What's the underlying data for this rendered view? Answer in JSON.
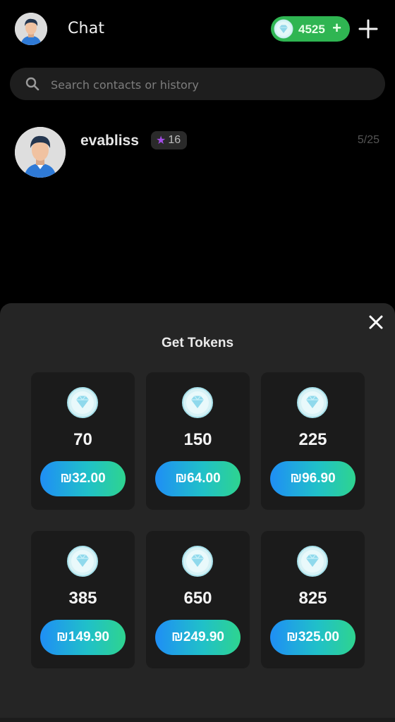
{
  "header": {
    "title": "Chat",
    "token_balance": "4525",
    "balance_plus": "+"
  },
  "search": {
    "placeholder": "Search contacts or history"
  },
  "contacts": [
    {
      "name": "evabliss",
      "level": "16",
      "date": "5/25"
    }
  ],
  "sheet": {
    "title": "Get Tokens",
    "packs": [
      {
        "amount": "70",
        "price": "₪32.00"
      },
      {
        "amount": "150",
        "price": "₪64.00"
      },
      {
        "amount": "225",
        "price": "₪96.90"
      },
      {
        "amount": "385",
        "price": "₪149.90"
      },
      {
        "amount": "650",
        "price": "₪249.90"
      },
      {
        "amount": "825",
        "price": "₪325.00"
      }
    ]
  },
  "colors": {
    "background": "#000000",
    "token_pill": "#2fb552",
    "sheet": "#252525",
    "pack_card": "#1b1b1b",
    "price_gradient_start": "#1f8ef5",
    "price_gradient_end": "#2ed48f",
    "level_star": "#a34de6"
  },
  "icons": [
    "avatar",
    "gem-icon",
    "plus-icon",
    "search-icon",
    "star-icon",
    "close-icon"
  ]
}
